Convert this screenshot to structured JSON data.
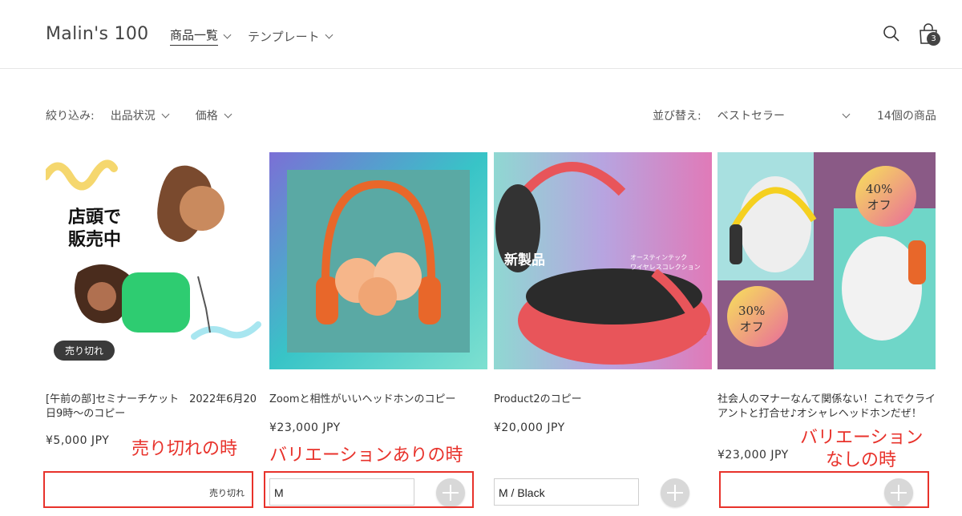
{
  "header": {
    "logo": "Malin's 100",
    "nav": [
      {
        "label": "商品一覧",
        "active": true
      },
      {
        "label": "テンプレート",
        "active": false
      }
    ],
    "cart_count": "3"
  },
  "filters": {
    "label": "絞り込み:",
    "items": [
      "出品状況",
      "価格"
    ],
    "sort_label": "並び替え:",
    "sort_value": "ベストセラー",
    "product_count": "14個の商品"
  },
  "products": [
    {
      "title": "[午前の部]セミナーチケット　2022年6月20日9時〜のコピー",
      "price": "¥5,000 JPY",
      "badge": "売り切れ",
      "variant": "",
      "soldout_label": "売り切れ",
      "image_text": [
        "店頭で",
        "販売中"
      ]
    },
    {
      "title": "Zoomと相性がいいヘッドホンのコピー",
      "price": "¥23,000 JPY",
      "variant": "M"
    },
    {
      "title": "Product2のコピー",
      "price": "¥20,000 JPY",
      "variant": "M / Black",
      "image_text": [
        "新製品",
        "オースティンテック",
        "ワイヤレスコレクション"
      ]
    },
    {
      "title": "社会人のマナーなんて関係ない！これでクライアントと打合せ♪オシャレヘッドホンだぜ！",
      "price": "¥23,000 JPY",
      "variant": "",
      "image_text": [
        "40%",
        "オフ",
        "30%",
        "オフ"
      ]
    }
  ],
  "annotations": {
    "soldout": "売り切れの時",
    "with_variation": "バリエーションありの時",
    "without_variation_line1": "バリエーション",
    "without_variation_line2": "なしの時"
  },
  "colors": {
    "annotation": "#e8322b",
    "badge": "#3a3a3a"
  }
}
